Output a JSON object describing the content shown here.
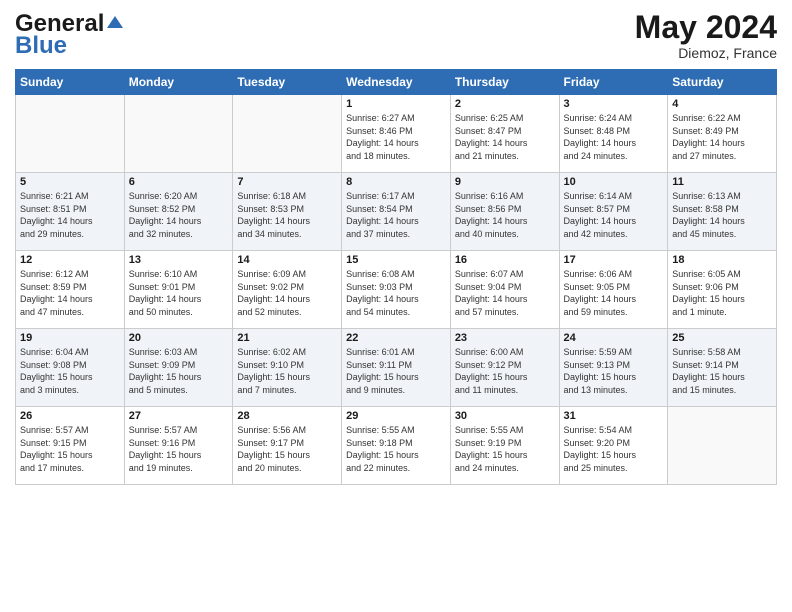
{
  "header": {
    "logo_general": "General",
    "logo_blue": "Blue",
    "month_title": "May 2024",
    "location": "Diemoz, France"
  },
  "days_of_week": [
    "Sunday",
    "Monday",
    "Tuesday",
    "Wednesday",
    "Thursday",
    "Friday",
    "Saturday"
  ],
  "weeks": [
    [
      {
        "day": "",
        "info": ""
      },
      {
        "day": "",
        "info": ""
      },
      {
        "day": "",
        "info": ""
      },
      {
        "day": "1",
        "info": "Sunrise: 6:27 AM\nSunset: 8:46 PM\nDaylight: 14 hours\nand 18 minutes."
      },
      {
        "day": "2",
        "info": "Sunrise: 6:25 AM\nSunset: 8:47 PM\nDaylight: 14 hours\nand 21 minutes."
      },
      {
        "day": "3",
        "info": "Sunrise: 6:24 AM\nSunset: 8:48 PM\nDaylight: 14 hours\nand 24 minutes."
      },
      {
        "day": "4",
        "info": "Sunrise: 6:22 AM\nSunset: 8:49 PM\nDaylight: 14 hours\nand 27 minutes."
      }
    ],
    [
      {
        "day": "5",
        "info": "Sunrise: 6:21 AM\nSunset: 8:51 PM\nDaylight: 14 hours\nand 29 minutes."
      },
      {
        "day": "6",
        "info": "Sunrise: 6:20 AM\nSunset: 8:52 PM\nDaylight: 14 hours\nand 32 minutes."
      },
      {
        "day": "7",
        "info": "Sunrise: 6:18 AM\nSunset: 8:53 PM\nDaylight: 14 hours\nand 34 minutes."
      },
      {
        "day": "8",
        "info": "Sunrise: 6:17 AM\nSunset: 8:54 PM\nDaylight: 14 hours\nand 37 minutes."
      },
      {
        "day": "9",
        "info": "Sunrise: 6:16 AM\nSunset: 8:56 PM\nDaylight: 14 hours\nand 40 minutes."
      },
      {
        "day": "10",
        "info": "Sunrise: 6:14 AM\nSunset: 8:57 PM\nDaylight: 14 hours\nand 42 minutes."
      },
      {
        "day": "11",
        "info": "Sunrise: 6:13 AM\nSunset: 8:58 PM\nDaylight: 14 hours\nand 45 minutes."
      }
    ],
    [
      {
        "day": "12",
        "info": "Sunrise: 6:12 AM\nSunset: 8:59 PM\nDaylight: 14 hours\nand 47 minutes."
      },
      {
        "day": "13",
        "info": "Sunrise: 6:10 AM\nSunset: 9:01 PM\nDaylight: 14 hours\nand 50 minutes."
      },
      {
        "day": "14",
        "info": "Sunrise: 6:09 AM\nSunset: 9:02 PM\nDaylight: 14 hours\nand 52 minutes."
      },
      {
        "day": "15",
        "info": "Sunrise: 6:08 AM\nSunset: 9:03 PM\nDaylight: 14 hours\nand 54 minutes."
      },
      {
        "day": "16",
        "info": "Sunrise: 6:07 AM\nSunset: 9:04 PM\nDaylight: 14 hours\nand 57 minutes."
      },
      {
        "day": "17",
        "info": "Sunrise: 6:06 AM\nSunset: 9:05 PM\nDaylight: 14 hours\nand 59 minutes."
      },
      {
        "day": "18",
        "info": "Sunrise: 6:05 AM\nSunset: 9:06 PM\nDaylight: 15 hours\nand 1 minute."
      }
    ],
    [
      {
        "day": "19",
        "info": "Sunrise: 6:04 AM\nSunset: 9:08 PM\nDaylight: 15 hours\nand 3 minutes."
      },
      {
        "day": "20",
        "info": "Sunrise: 6:03 AM\nSunset: 9:09 PM\nDaylight: 15 hours\nand 5 minutes."
      },
      {
        "day": "21",
        "info": "Sunrise: 6:02 AM\nSunset: 9:10 PM\nDaylight: 15 hours\nand 7 minutes."
      },
      {
        "day": "22",
        "info": "Sunrise: 6:01 AM\nSunset: 9:11 PM\nDaylight: 15 hours\nand 9 minutes."
      },
      {
        "day": "23",
        "info": "Sunrise: 6:00 AM\nSunset: 9:12 PM\nDaylight: 15 hours\nand 11 minutes."
      },
      {
        "day": "24",
        "info": "Sunrise: 5:59 AM\nSunset: 9:13 PM\nDaylight: 15 hours\nand 13 minutes."
      },
      {
        "day": "25",
        "info": "Sunrise: 5:58 AM\nSunset: 9:14 PM\nDaylight: 15 hours\nand 15 minutes."
      }
    ],
    [
      {
        "day": "26",
        "info": "Sunrise: 5:57 AM\nSunset: 9:15 PM\nDaylight: 15 hours\nand 17 minutes."
      },
      {
        "day": "27",
        "info": "Sunrise: 5:57 AM\nSunset: 9:16 PM\nDaylight: 15 hours\nand 19 minutes."
      },
      {
        "day": "28",
        "info": "Sunrise: 5:56 AM\nSunset: 9:17 PM\nDaylight: 15 hours\nand 20 minutes."
      },
      {
        "day": "29",
        "info": "Sunrise: 5:55 AM\nSunset: 9:18 PM\nDaylight: 15 hours\nand 22 minutes."
      },
      {
        "day": "30",
        "info": "Sunrise: 5:55 AM\nSunset: 9:19 PM\nDaylight: 15 hours\nand 24 minutes."
      },
      {
        "day": "31",
        "info": "Sunrise: 5:54 AM\nSunset: 9:20 PM\nDaylight: 15 hours\nand 25 minutes."
      },
      {
        "day": "",
        "info": ""
      }
    ]
  ]
}
